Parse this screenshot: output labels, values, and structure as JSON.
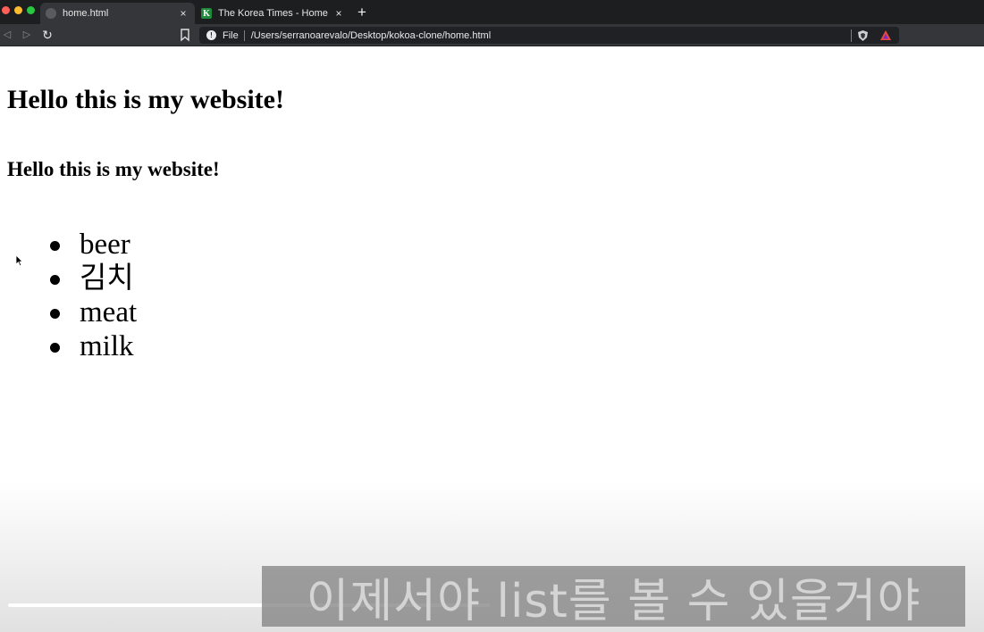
{
  "browser": {
    "tabs": [
      {
        "title": "home.html",
        "active": true
      },
      {
        "title": "The Korea Times - Home",
        "favicon_letter": "K",
        "active": false
      }
    ],
    "close_glyph": "×",
    "new_tab_glyph": "+",
    "address": {
      "scheme_label": "File",
      "url": "/Users/serranoarevalo/Desktop/kokoa-clone/home.html"
    },
    "accent_colors": {
      "close": "#fe5f57",
      "minimize": "#febc2e",
      "zoom": "#28c840",
      "korea_times": "#1e8a3c"
    }
  },
  "page": {
    "h1": "Hello this is my website!",
    "h3": "Hello this is my website!",
    "list": [
      "beer",
      "김치",
      "meat",
      "milk"
    ]
  },
  "video": {
    "caption": "이제서야 list를 볼 수 있을거야",
    "progress_percent": 49
  }
}
